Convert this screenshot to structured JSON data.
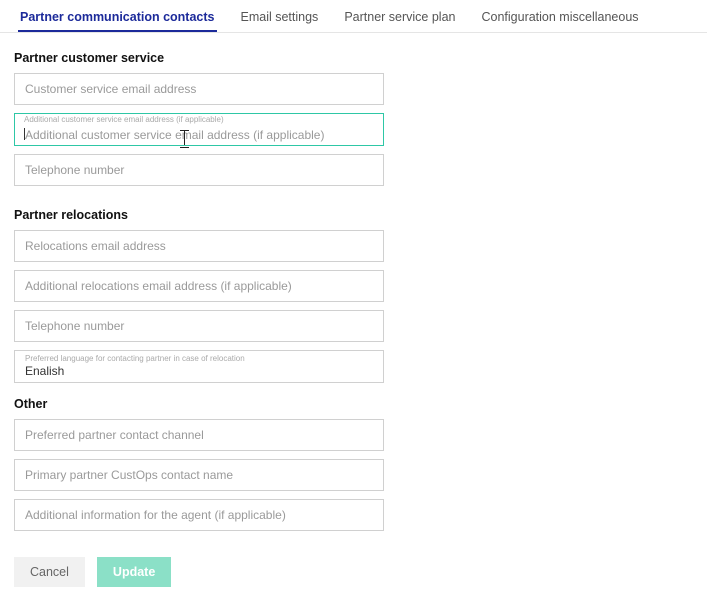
{
  "tabs": [
    {
      "label": "Partner communication contacts",
      "active": true
    },
    {
      "label": "Email settings",
      "active": false
    },
    {
      "label": "Partner service plan",
      "active": false
    },
    {
      "label": "Configuration miscellaneous",
      "active": false
    }
  ],
  "sections": {
    "customer_service": {
      "title": "Partner customer service",
      "fields": {
        "email": {
          "placeholder": "Customer service email address",
          "value": ""
        },
        "additional_email": {
          "placeholder": "Additional customer service email address (if applicable)",
          "float_label": "Additional customer service email address (if applicable)",
          "value": ""
        },
        "phone": {
          "placeholder": "Telephone number",
          "value": ""
        }
      }
    },
    "relocations": {
      "title": "Partner relocations",
      "fields": {
        "email": {
          "placeholder": "Relocations email address",
          "value": ""
        },
        "additional_email": {
          "placeholder": "Additional relocations email address (if applicable)",
          "value": ""
        },
        "phone": {
          "placeholder": "Telephone number",
          "value": ""
        },
        "language": {
          "label": "Preferred language for contacting partner in case of relocation",
          "value": "Enalish"
        }
      }
    },
    "other": {
      "title": "Other",
      "fields": {
        "channel": {
          "placeholder": "Preferred partner contact channel",
          "value": ""
        },
        "custops": {
          "placeholder": "Primary partner CustOps contact name",
          "value": ""
        },
        "additional": {
          "placeholder": "Additional information for the agent (if applicable)",
          "value": ""
        }
      }
    }
  },
  "buttons": {
    "cancel": "Cancel",
    "update": "Update"
  }
}
